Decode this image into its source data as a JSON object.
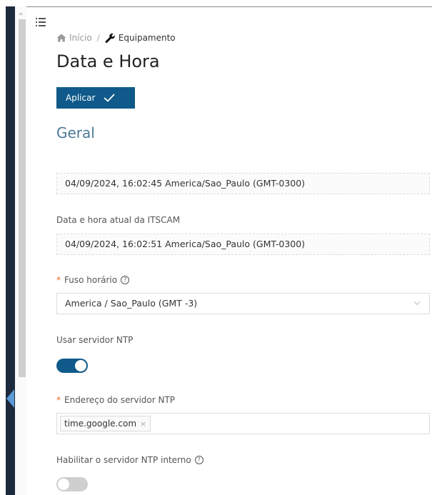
{
  "breadcrumb": {
    "home_label": "Início",
    "separator": "/",
    "current_label": "Equipamento"
  },
  "page": {
    "title": "Data e Hora"
  },
  "toolbar": {
    "apply_label": "Aplicar"
  },
  "section": {
    "title": "Geral"
  },
  "fields": {
    "local_datetime_value": "04/09/2024, 16:02:45 America/Sao_Paulo (GMT-0300)",
    "itscam_datetime_label": "Data e hora atual da ITSCAM",
    "itscam_datetime_value": "04/09/2024, 16:02:51 America/Sao_Paulo (GMT-0300)",
    "timezone_label": "Fuso horário",
    "timezone_value": "America / Sao_Paulo (GMT -3)",
    "use_ntp_label": "Usar servidor NTP",
    "use_ntp_on": true,
    "ntp_address_label": "Endereço do servidor NTP",
    "ntp_servers": [
      "time.google.com"
    ],
    "internal_ntp_label": "Habilitar o servidor NTP interno",
    "internal_ntp_on": false
  },
  "symbols": {
    "required": "*",
    "help": "?",
    "remove": "×"
  },
  "colors": {
    "primary": "#0f5a8a",
    "required": "#e8681a",
    "section_title": "#4a7a97",
    "sidebar": "#1d2a3d"
  }
}
